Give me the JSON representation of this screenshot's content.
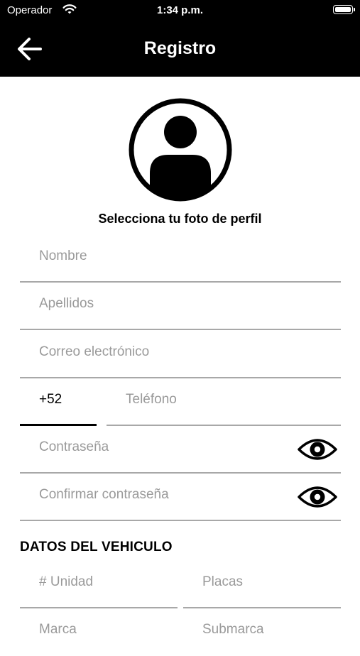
{
  "status_bar": {
    "carrier": "Operador",
    "time": "1:34 p.m."
  },
  "nav": {
    "title": "Registro",
    "back_icon": "arrow-left-icon"
  },
  "profile": {
    "avatar_icon": "user-circle-icon",
    "caption": "Selecciona tu foto de perfil"
  },
  "form": {
    "nombre_placeholder": "Nombre",
    "apellidos_placeholder": "Apellidos",
    "correo_placeholder": "Correo electrónico",
    "country_code": "+52",
    "telefono_placeholder": "Teléfono",
    "contrasena_placeholder": "Contraseña",
    "confirmar_placeholder": "Confirmar contraseña",
    "eye_icon": "eye-icon"
  },
  "vehicle": {
    "section_title": "DATOS DEL VEHICULO",
    "unidad_placeholder": "# Unidad",
    "placas_placeholder": "Placas",
    "marca_placeholder": "Marca",
    "submarca_placeholder": "Submarca"
  },
  "colors": {
    "bar": "#000000",
    "placeholder": "#9a9a9a",
    "underline": "#a8a8a8"
  }
}
